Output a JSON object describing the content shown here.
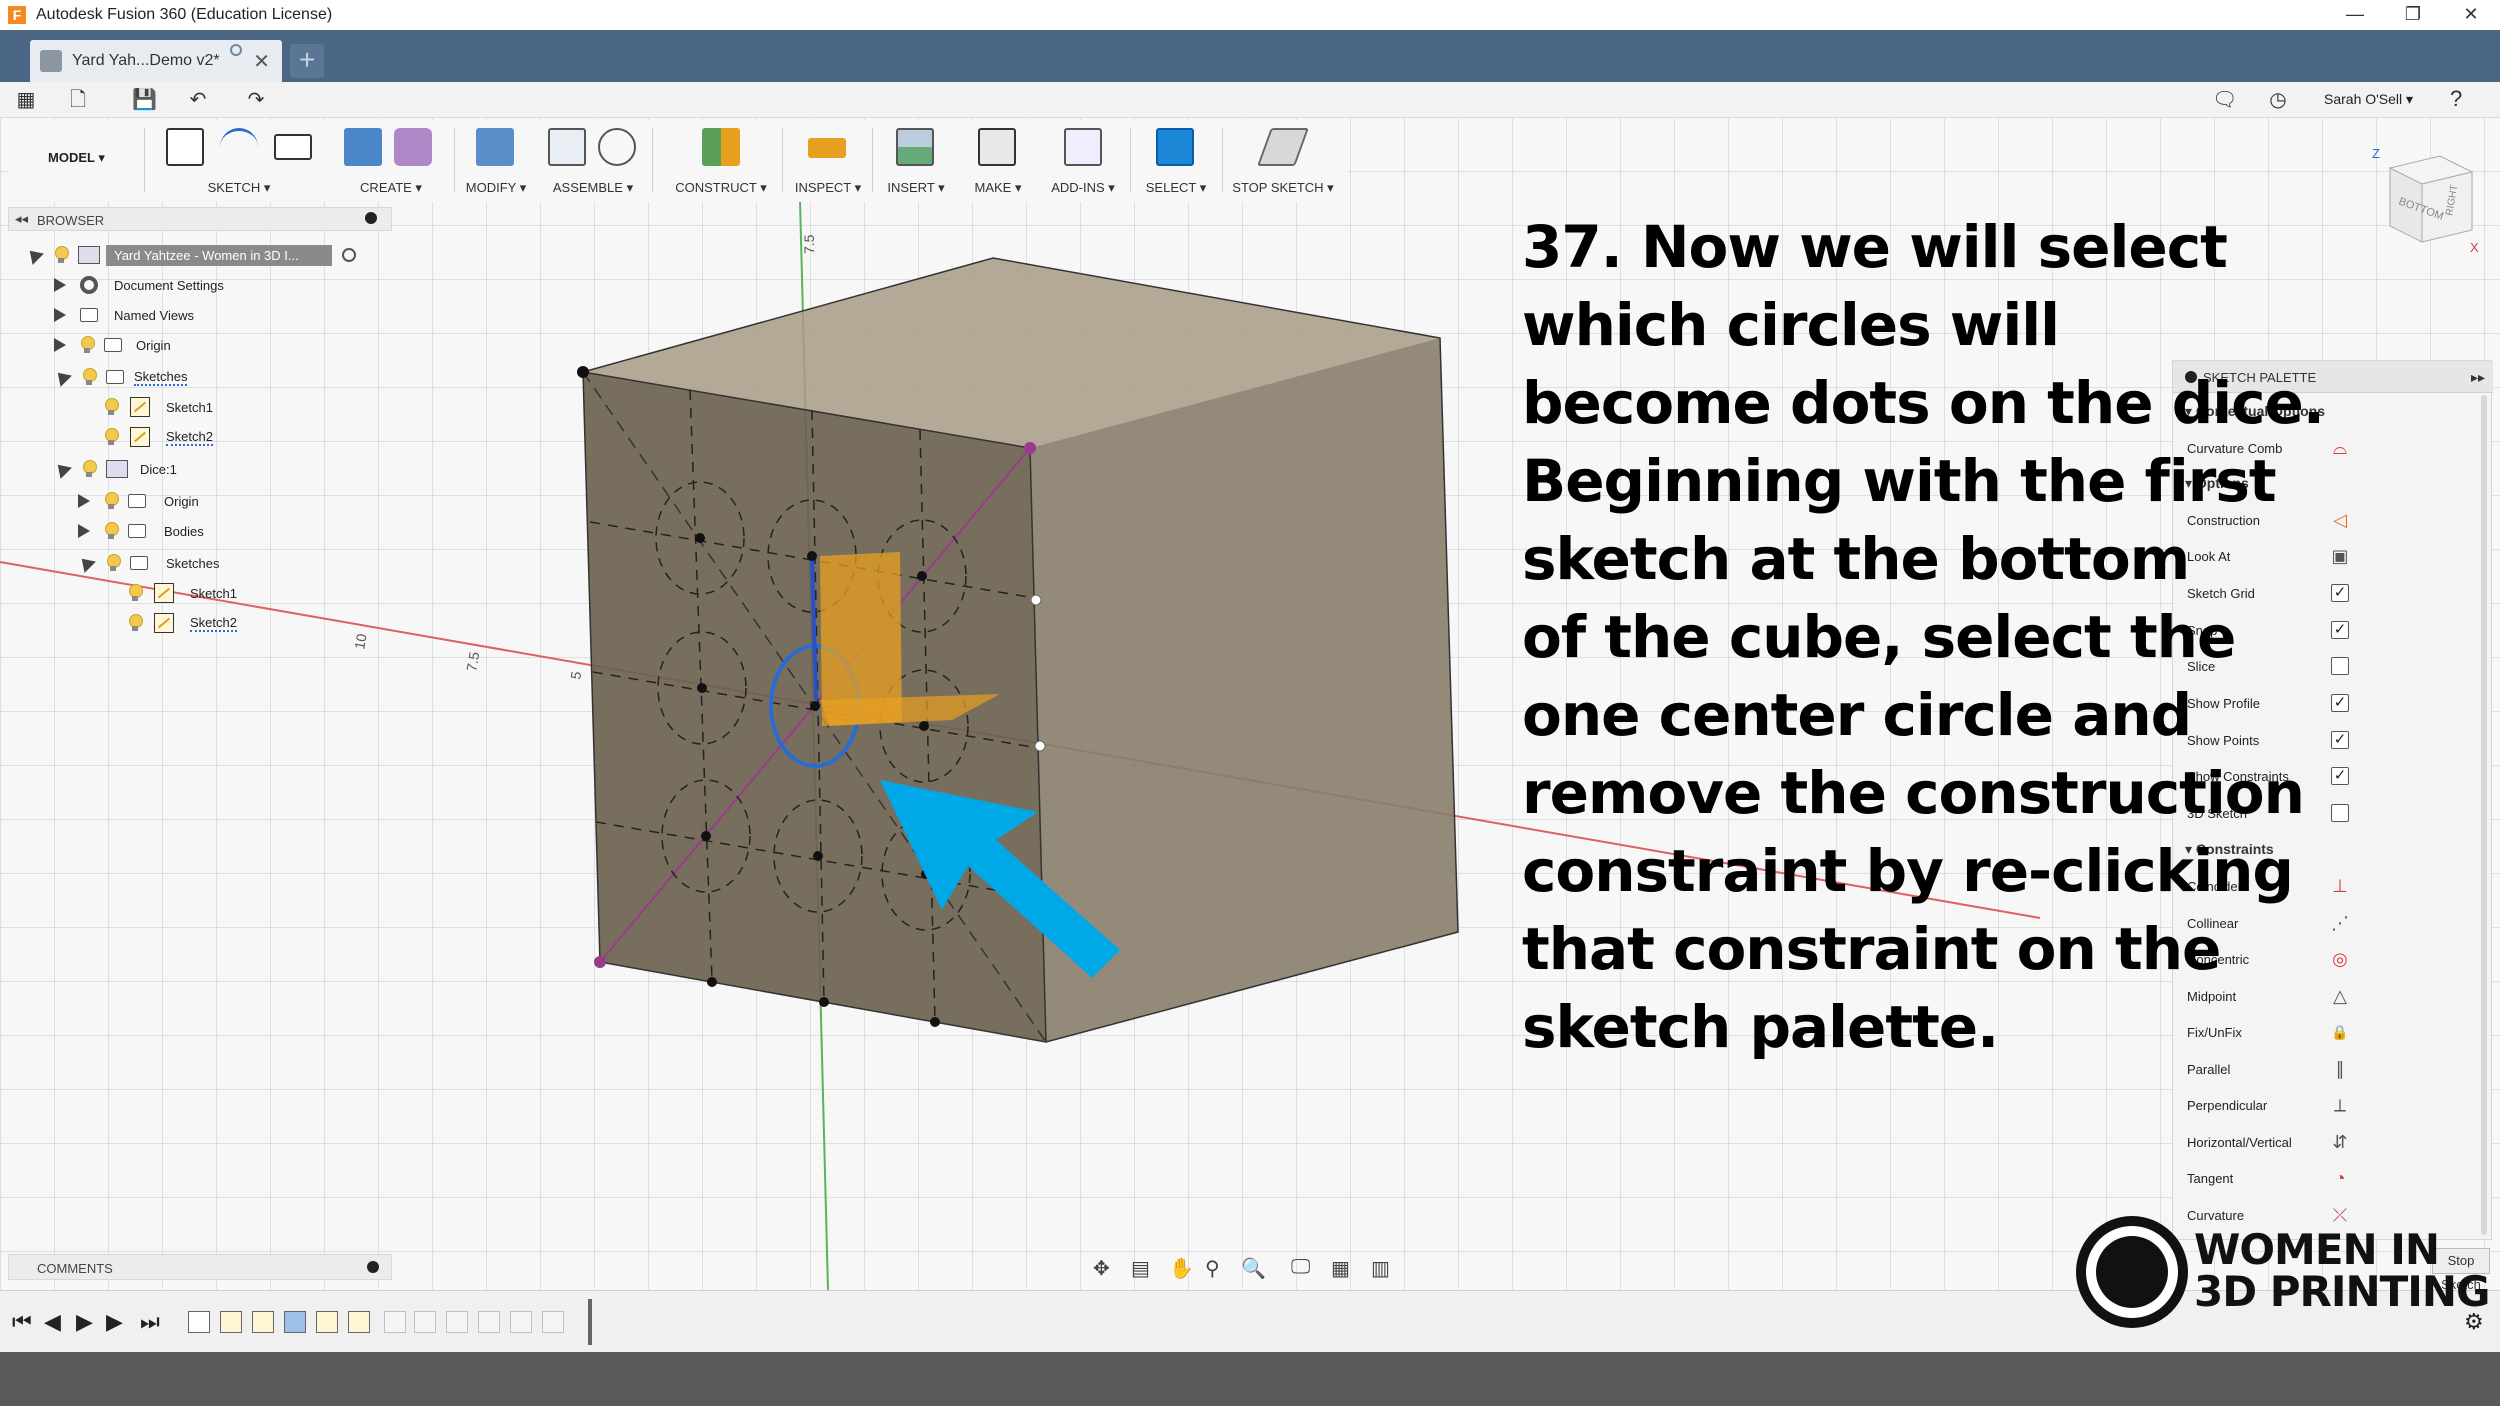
{
  "window": {
    "app_icon": "F",
    "title": "Autodesk Fusion 360 (Education License)",
    "controls": [
      "—",
      "❐",
      "✕"
    ]
  },
  "tab": {
    "label": "Yard Yah...Demo v2*",
    "close": "✕",
    "new": "+"
  },
  "quickbar": {
    "user": "Sarah O'Sell ▾",
    "help": "?"
  },
  "toolbar": {
    "workspace": "MODEL ▾",
    "groups": [
      {
        "label": "SKETCH ▾"
      },
      {
        "label": "CREATE ▾"
      },
      {
        "label": "MODIFY ▾"
      },
      {
        "label": "ASSEMBLE ▾"
      },
      {
        "label": "CONSTRUCT ▾"
      },
      {
        "label": "INSPECT ▾"
      },
      {
        "label": "INSERT ▾"
      },
      {
        "label": "MAKE ▾"
      },
      {
        "label": "ADD-INS ▾"
      },
      {
        "label": "SELECT ▾"
      },
      {
        "label": "STOP SKETCH ▾"
      }
    ]
  },
  "browser": {
    "header": "BROWSER",
    "root": "Yard Yahtzee - Women in 3D I...",
    "items": [
      {
        "label": "Document Settings"
      },
      {
        "label": "Named Views"
      },
      {
        "label": "Origin"
      },
      {
        "label": "Sketches"
      },
      {
        "label": "Sketch1"
      },
      {
        "label": "Sketch2"
      },
      {
        "label": "Dice:1"
      },
      {
        "label": "Origin"
      },
      {
        "label": "Bodies"
      },
      {
        "label": "Sketches"
      },
      {
        "label": "Sketch1"
      },
      {
        "label": "Sketch2"
      }
    ]
  },
  "comments": {
    "label": "COMMENTS"
  },
  "palette": {
    "header": "SKETCH PALETTE",
    "sections": {
      "contextual": "Contextual Options",
      "options": "Options",
      "constraints": "Constraints"
    },
    "contextual_items": [
      {
        "label": "Curvature Comb",
        "icon": "curvature-comb-icon",
        "glyph": "⌓"
      }
    ],
    "options": [
      {
        "label": "Construction",
        "type": "icon",
        "glyph": "◁"
      },
      {
        "label": "Look At",
        "type": "icon",
        "glyph": "▣"
      },
      {
        "label": "Sketch Grid",
        "type": "check",
        "checked": true
      },
      {
        "label": "Snap",
        "type": "check",
        "checked": true
      },
      {
        "label": "Slice",
        "type": "check",
        "checked": false
      },
      {
        "label": "Show Profile",
        "type": "check",
        "checked": true
      },
      {
        "label": "Show Points",
        "type": "check",
        "checked": true
      },
      {
        "label": "Show Constraints",
        "type": "check",
        "checked": true
      },
      {
        "label": "3D Sketch",
        "type": "check",
        "checked": false
      }
    ],
    "constraints": [
      {
        "label": "Coincident",
        "glyph": "⊥"
      },
      {
        "label": "Collinear",
        "glyph": "⋰"
      },
      {
        "label": "Concentric",
        "glyph": "◎"
      },
      {
        "label": "Midpoint",
        "glyph": "△"
      },
      {
        "label": "Fix/UnFix",
        "glyph": "🔒"
      },
      {
        "label": "Parallel",
        "glyph": "∥"
      },
      {
        "label": "Perpendicular",
        "glyph": "⟂"
      },
      {
        "label": "Horizontal/Vertical",
        "glyph": "⇵"
      },
      {
        "label": "Tangent",
        "glyph": "◔"
      },
      {
        "label": "Curvature",
        "glyph": "⤫"
      }
    ],
    "stop_button": "Stop Sketch"
  },
  "instruction": {
    "lines": [
      "37. Now we will select",
      "which circles will",
      "become dots on the dice.",
      "Beginning with the first",
      "sketch at the bottom",
      "of the cube, select the",
      "one center circle and",
      "remove the construction",
      "constraint by re-clicking",
      "that constraint on the",
      "sketch palette."
    ]
  },
  "logo": {
    "line1": "WOMEN IN",
    "line2": "3D PRINTING"
  },
  "viewcube": {
    "top": "BOTTOM",
    "right": "RIGHT",
    "axis_z": "Z",
    "axis_x": "X"
  },
  "canvas_labels": {
    "tick_a": "7.5",
    "tick_b": "10",
    "tick_c": "7.5",
    "tick_d": "5"
  },
  "colors": {
    "tabbar": "#4a6684",
    "cube_face": "#6d6250",
    "cube_top": "#9c8f7a",
    "arrow": "#00a8e8",
    "selection": "#2a6bd1"
  }
}
